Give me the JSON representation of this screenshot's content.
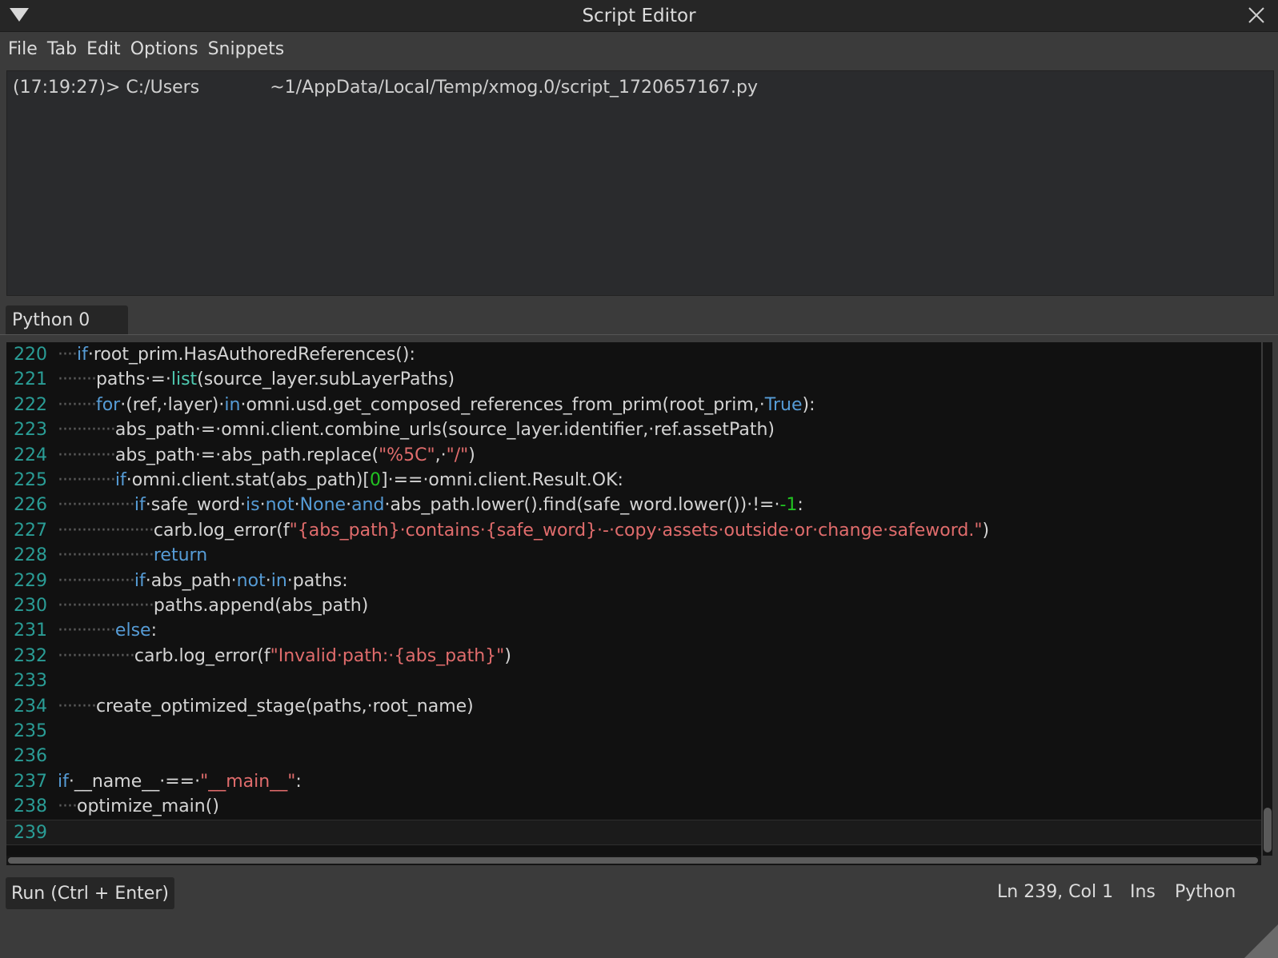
{
  "window": {
    "title": "Script Editor"
  },
  "menu": [
    "File",
    "Tab",
    "Edit",
    "Options",
    "Snippets"
  ],
  "output": {
    "prefix": "(17:19:27)> C:/Users",
    "suffix": "~1/AppData/Local/Temp/xmog.0/script_1720657167.py"
  },
  "tabs": [
    {
      "label": "Python 0"
    }
  ],
  "editor": {
    "lines": [
      {
        "num": "220",
        "indent": 1,
        "tokens": [
          [
            "kw",
            "if"
          ],
          [
            "",
            "·root_prim.HasAuthoredReferences():"
          ]
        ]
      },
      {
        "num": "221",
        "indent": 2,
        "tokens": [
          [
            "",
            "paths·=·"
          ],
          [
            "bi",
            "list"
          ],
          [
            "",
            "(source_layer.subLayerPaths)"
          ]
        ]
      },
      {
        "num": "222",
        "indent": 2,
        "tokens": [
          [
            "kw",
            "for"
          ],
          [
            "",
            "·(ref,·layer)·"
          ],
          [
            "kw",
            "in"
          ],
          [
            "",
            "·omni.usd.get_composed_references_from_prim(root_prim,·"
          ],
          [
            "kw",
            "True"
          ],
          [
            "",
            "):"
          ]
        ]
      },
      {
        "num": "223",
        "indent": 3,
        "tokens": [
          [
            "",
            "abs_path·=·omni.client.combine_urls(source_layer.identifier,·ref.assetPath)"
          ]
        ]
      },
      {
        "num": "224",
        "indent": 3,
        "tokens": [
          [
            "",
            "abs_path·=·abs_path.replace("
          ],
          [
            "str",
            "\"%5C\""
          ],
          [
            "",
            ",·"
          ],
          [
            "str",
            "\"/\""
          ],
          [
            "",
            ")"
          ]
        ]
      },
      {
        "num": "225",
        "indent": 3,
        "tokens": [
          [
            "kw",
            "if"
          ],
          [
            "",
            "·omni.client.stat(abs_path)["
          ],
          [
            "num",
            "0"
          ],
          [
            "",
            "]·==·omni.client.Result.OK:"
          ]
        ]
      },
      {
        "num": "226",
        "indent": 4,
        "tokens": [
          [
            "kw",
            "if"
          ],
          [
            "",
            "·safe_word·"
          ],
          [
            "kw",
            "is"
          ],
          [
            "",
            "·"
          ],
          [
            "kw",
            "not"
          ],
          [
            "",
            "·"
          ],
          [
            "kw",
            "None"
          ],
          [
            "",
            "·"
          ],
          [
            "kw",
            "and"
          ],
          [
            "",
            "·abs_path.lower().find(safe_word.lower())·!=·"
          ],
          [
            "num",
            "-1"
          ],
          [
            "",
            ":"
          ]
        ]
      },
      {
        "num": "227",
        "indent": 5,
        "tokens": [
          [
            "",
            "carb.log_error(f"
          ],
          [
            "str",
            "\"{abs_path}·contains·{safe_word}·-·copy·assets·outside·or·change·safeword.\""
          ],
          [
            "",
            ")"
          ]
        ]
      },
      {
        "num": "228",
        "indent": 5,
        "tokens": [
          [
            "kw",
            "return"
          ]
        ]
      },
      {
        "num": "229",
        "indent": 4,
        "tokens": [
          [
            "kw",
            "if"
          ],
          [
            "",
            "·abs_path·"
          ],
          [
            "kw",
            "not"
          ],
          [
            "",
            "·"
          ],
          [
            "kw",
            "in"
          ],
          [
            "",
            "·paths:"
          ]
        ]
      },
      {
        "num": "230",
        "indent": 5,
        "tokens": [
          [
            "",
            "paths.append(abs_path)"
          ]
        ]
      },
      {
        "num": "231",
        "indent": 3,
        "tokens": [
          [
            "kw",
            "else"
          ],
          [
            "",
            ":"
          ]
        ]
      },
      {
        "num": "232",
        "indent": 4,
        "tokens": [
          [
            "",
            "carb.log_error(f"
          ],
          [
            "str",
            "\"Invalid·path:·{abs_path}\""
          ],
          [
            "",
            ")"
          ]
        ]
      },
      {
        "num": "233",
        "indent": 0,
        "tokens": []
      },
      {
        "num": "234",
        "indent": 2,
        "tokens": [
          [
            "",
            "create_optimized_stage(paths,·root_name)"
          ]
        ]
      },
      {
        "num": "235",
        "indent": 0,
        "tokens": []
      },
      {
        "num": "236",
        "indent": 0,
        "tokens": []
      },
      {
        "num": "237",
        "indent": 0,
        "tokens": [
          [
            "kw",
            "if"
          ],
          [
            "",
            "·__name__·==·"
          ],
          [
            "str",
            "\"__main__\""
          ],
          [
            "",
            ":"
          ]
        ]
      },
      {
        "num": "238",
        "indent": 1,
        "tokens": [
          [
            "",
            "optimize_main()"
          ]
        ]
      },
      {
        "num": "239",
        "indent": 0,
        "tokens": [],
        "current": true
      }
    ]
  },
  "toolbar": {
    "run_label": "Run (Ctrl + Enter)"
  },
  "status": {
    "position": "Ln 239, Col 1",
    "mode": "Ins",
    "language": "Python"
  }
}
